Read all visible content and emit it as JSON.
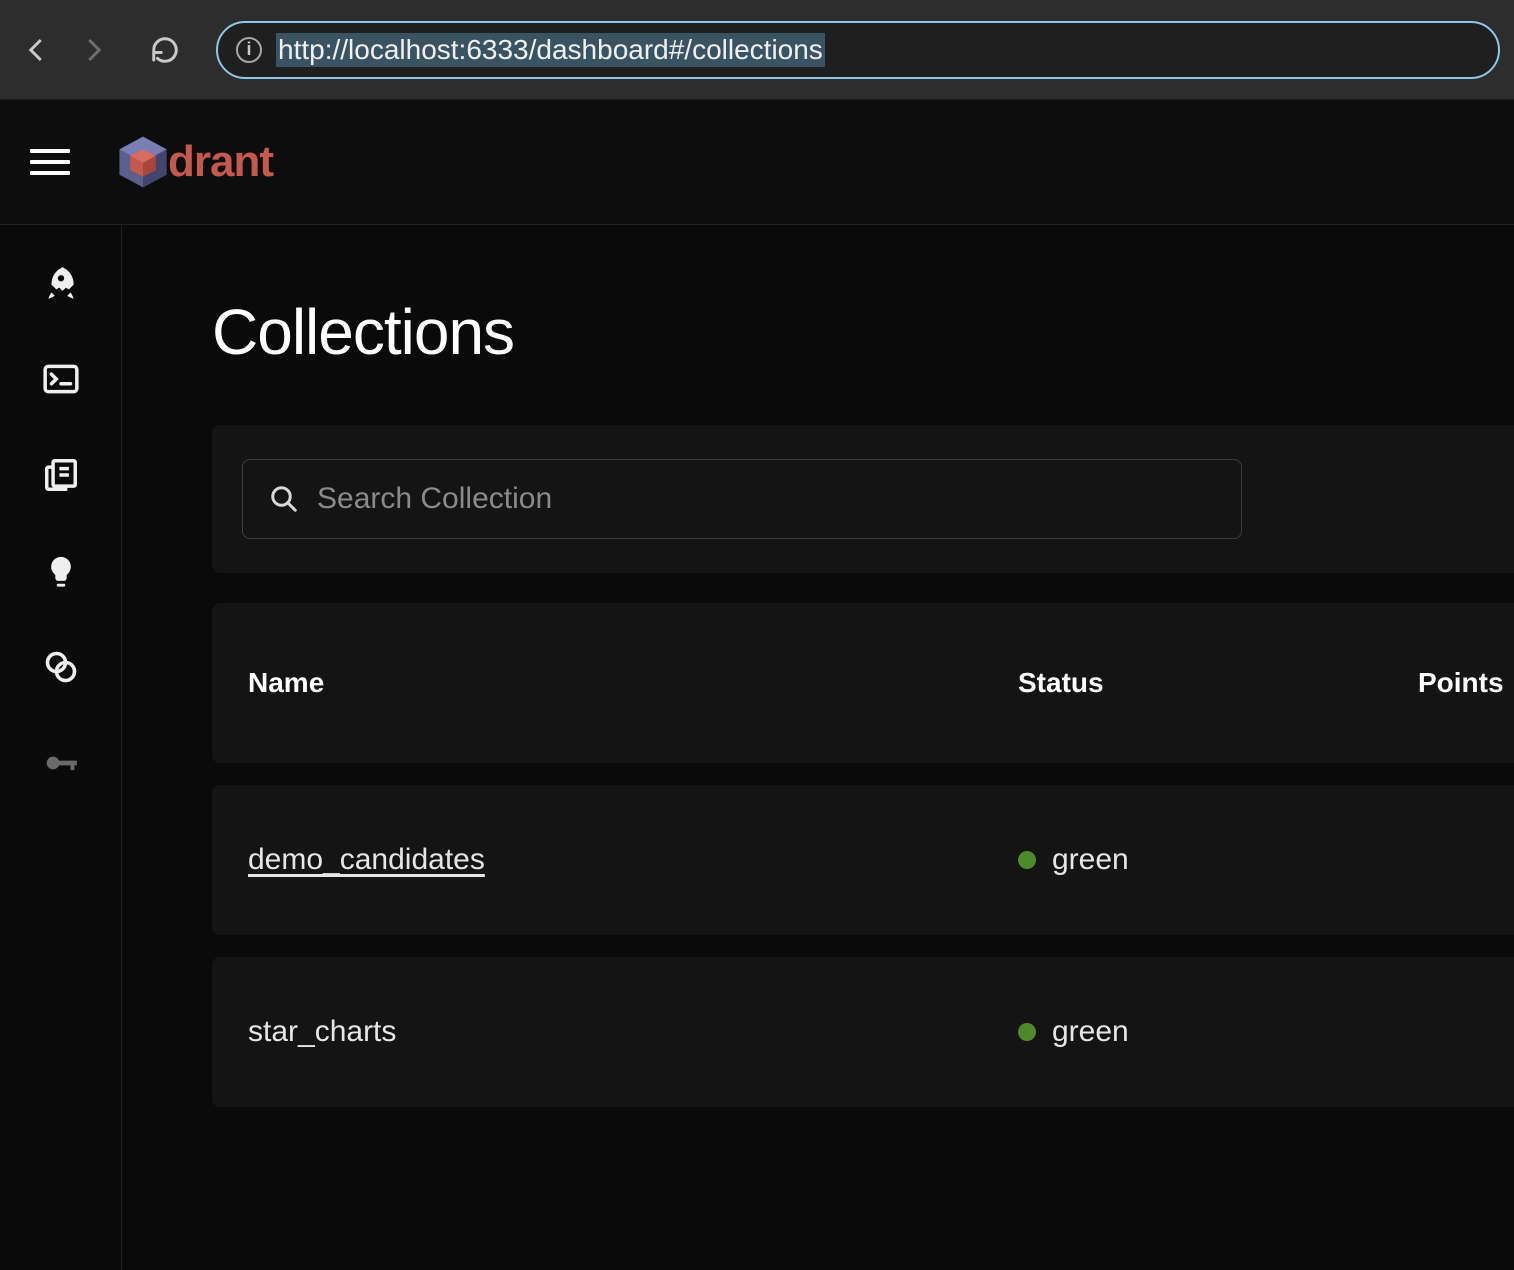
{
  "browser": {
    "url": "http://localhost:6333/dashboard#/collections"
  },
  "branding": {
    "logo_text": "drant"
  },
  "sidebar": {
    "items": [
      {
        "name": "rocket"
      },
      {
        "name": "console"
      },
      {
        "name": "documents"
      },
      {
        "name": "bulb"
      },
      {
        "name": "datasets"
      },
      {
        "name": "key"
      }
    ]
  },
  "page": {
    "title": "Collections",
    "search_placeholder": "Search Collection"
  },
  "table": {
    "columns": {
      "name": "Name",
      "status": "Status",
      "points": "Points"
    },
    "rows": [
      {
        "name": "demo_candidates",
        "status": "green",
        "status_color": "#4f8a2a",
        "link": true
      },
      {
        "name": "star_charts",
        "status": "green",
        "status_color": "#4f8a2a",
        "link": false
      }
    ]
  }
}
